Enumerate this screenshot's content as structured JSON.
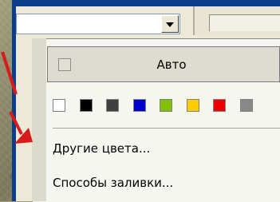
{
  "color_picker": {
    "auto_label": "Авто",
    "swatches": [
      "#ffffff",
      "#000000",
      "#404040",
      "#0000cc",
      "#80c000",
      "#ffcc00",
      "#ee0000",
      "#888888"
    ],
    "more_colors_label": "Другие цвета...",
    "fill_effects_label": "Способы заливки..."
  },
  "colors": {
    "frame": "#0a3d8a",
    "arrow": "#d81b1b"
  },
  "icons": [
    "dropdown-arrow-icon"
  ]
}
